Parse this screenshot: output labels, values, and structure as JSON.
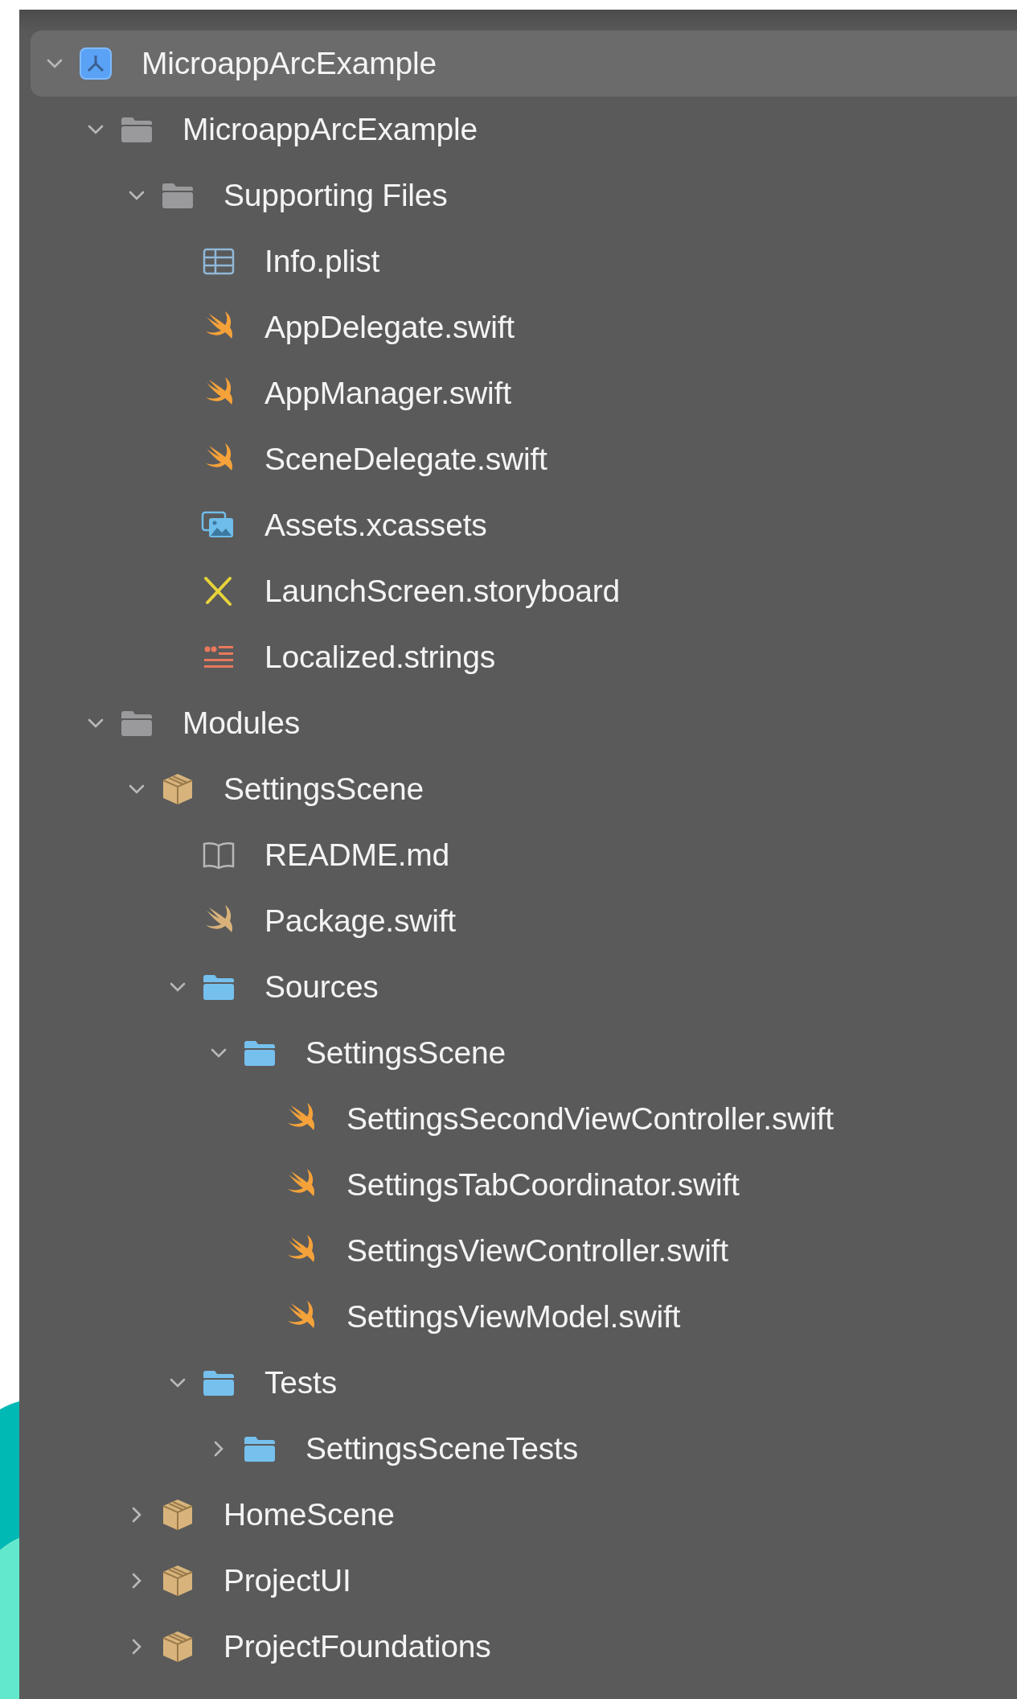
{
  "navigator": {
    "tree": [
      {
        "label": "MicroappArcExample",
        "kind": "project",
        "selected": true,
        "expanded": true,
        "children": [
          {
            "label": "MicroappArcExample",
            "kind": "group",
            "selected": false,
            "expanded": true,
            "children": [
              {
                "label": "Supporting Files",
                "kind": "group",
                "selected": false,
                "expanded": true,
                "children": [
                  {
                    "label": "Info.plist",
                    "kind": "plist",
                    "selected": false
                  },
                  {
                    "label": "AppDelegate.swift",
                    "kind": "swift",
                    "selected": false
                  },
                  {
                    "label": "AppManager.swift",
                    "kind": "swift",
                    "selected": false
                  },
                  {
                    "label": "SceneDelegate.swift",
                    "kind": "swift",
                    "selected": false
                  },
                  {
                    "label": "Assets.xcassets",
                    "kind": "assets",
                    "selected": false
                  },
                  {
                    "label": "LaunchScreen.storyboard",
                    "kind": "storyboard",
                    "selected": false
                  },
                  {
                    "label": "Localized.strings",
                    "kind": "strings",
                    "selected": false
                  }
                ]
              }
            ]
          },
          {
            "label": "Modules",
            "kind": "group",
            "selected": false,
            "expanded": true,
            "children": [
              {
                "label": "SettingsScene",
                "kind": "package",
                "selected": false,
                "expanded": true,
                "children": [
                  {
                    "label": "README.md",
                    "kind": "markdown",
                    "selected": false
                  },
                  {
                    "label": "Package.swift",
                    "kind": "manifest",
                    "selected": false
                  },
                  {
                    "label": "Sources",
                    "kind": "folder",
                    "selected": false,
                    "expanded": true,
                    "children": [
                      {
                        "label": "SettingsScene",
                        "kind": "folder",
                        "selected": false,
                        "expanded": true,
                        "children": [
                          {
                            "label": "SettingsSecondViewController.swift",
                            "kind": "swift",
                            "selected": false
                          },
                          {
                            "label": "SettingsTabCoordinator.swift",
                            "kind": "swift",
                            "selected": false
                          },
                          {
                            "label": "SettingsViewController.swift",
                            "kind": "swift",
                            "selected": false
                          },
                          {
                            "label": "SettingsViewModel.swift",
                            "kind": "swift",
                            "selected": false
                          }
                        ]
                      }
                    ]
                  },
                  {
                    "label": "Tests",
                    "kind": "folder",
                    "selected": false,
                    "expanded": true,
                    "children": [
                      {
                        "label": "SettingsSceneTests",
                        "kind": "folder",
                        "selected": false,
                        "expanded": false
                      }
                    ]
                  }
                ]
              },
              {
                "label": "HomeScene",
                "kind": "package",
                "selected": false,
                "expanded": false
              },
              {
                "label": "ProjectUI",
                "kind": "package",
                "selected": false,
                "expanded": false
              },
              {
                "label": "ProjectFoundations",
                "kind": "package",
                "selected": false,
                "expanded": false
              }
            ]
          }
        ]
      }
    ]
  }
}
